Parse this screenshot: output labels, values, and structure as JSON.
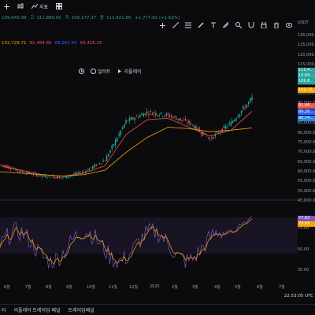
{
  "top_bar": {
    "items": [
      {
        "label": "",
        "icon": "plus-icon"
      },
      {
        "label": "",
        "icon": "candles-icon"
      },
      {
        "label": "지표",
        "icon": "indicator-icon"
      },
      {
        "label": "",
        "icon": "grid-icon"
      }
    ]
  },
  "toolbar_right": [
    "cursor-icon",
    "trendline-icon",
    "fib-icon",
    "pen-icon",
    "text-icon",
    "measure-icon",
    "zoom-icon",
    "magnet-icon",
    "lock-icon",
    "trash-icon",
    "eye-icon"
  ],
  "ohlc": {
    "o": "109,643.99",
    "h": "111,880.00",
    "l": "109,177.37",
    "c": "111,421.80",
    "chg": "+1,777.81 (+1.62%)"
  },
  "indicators": {
    "ma1": "102,729.71",
    "ma2": "91,484.85",
    "ma3": "89,281.55",
    "ma4": "93,416.25"
  },
  "mid_toolbar": [
    {
      "label": "",
      "icon": "clock-icon"
    },
    {
      "label": "얼러트",
      "icon": "alert-icon"
    },
    {
      "label": "리플레이",
      "icon": "replay-icon"
    }
  ],
  "axis": {
    "currency": "USDT",
    "price_ticks": [
      "130,000.00",
      "125,000.00",
      "120,000.00",
      "115,000.00",
      "110,000.00",
      "105,000.00",
      "100,000.00",
      "95,000.00",
      "90,000.00",
      "85,000.00",
      "80,000.00",
      "75,000.00",
      "70,000.00",
      "65,000.00",
      "60,000.00",
      "55,000.00",
      "50,000.00",
      "45,000.00"
    ],
    "rsi_ticks": [
      "80.00",
      "70.00",
      "50.00",
      "30.00"
    ],
    "tags": [
      {
        "text": "111,4…",
        "color": "#26a69a"
      },
      {
        "text": "10:06:…",
        "color": "#26a69a"
      },
      {
        "text": "106,8…",
        "color": "#26a69a"
      },
      {
        "text": "102,72…",
        "color": "#f7a600"
      },
      {
        "text": "91,48…",
        "color": "#ef5350"
      },
      {
        "text": "89,28…",
        "color": "#2962ff"
      },
      {
        "text": "90,74…",
        "color": "#1e88e5"
      },
      {
        "text": "77.83",
        "color": "#7e57c2"
      },
      {
        "text": "73.03",
        "color": "#f7a600"
      }
    ]
  },
  "months": [
    "6월",
    "7월",
    "8월",
    "9월",
    "10월",
    "11월",
    "12월",
    "2025",
    "2월",
    "3월",
    "4월",
    "5월",
    "6월",
    "7월"
  ],
  "clock": "22:53:05 UTC",
  "bottom_tabs": [
    "터",
    "리플레이 트레이딩 패널",
    "트레이딩패널"
  ],
  "chart_data": {
    "type": "line",
    "title": "",
    "xlabel": "",
    "ylabel": "",
    "x": [
      "6월",
      "7월",
      "8월",
      "9월",
      "10월",
      "11월",
      "12월",
      "2025",
      "2월",
      "3월",
      "4월",
      "5월",
      "6월"
    ],
    "ylim": [
      45000,
      130000
    ],
    "series": [
      {
        "values": [
          67000,
          62000,
          59000,
          58000,
          62000,
          70000,
          96000,
          102000,
          100000,
          95000,
          84000,
          95000,
          111421
        ]
      },
      {
        "values": [
          66000,
          63000,
          60000,
          59000,
          61000,
          66000,
          87000,
          97000,
          98000,
          92000,
          86000,
          90000,
          102729
        ]
      },
      {
        "values": [
          62000,
          61000,
          60000,
          59000,
          60000,
          63000,
          75000,
          85000,
          92000,
          91000,
          89000,
          90000,
          91484
        ]
      }
    ]
  }
}
